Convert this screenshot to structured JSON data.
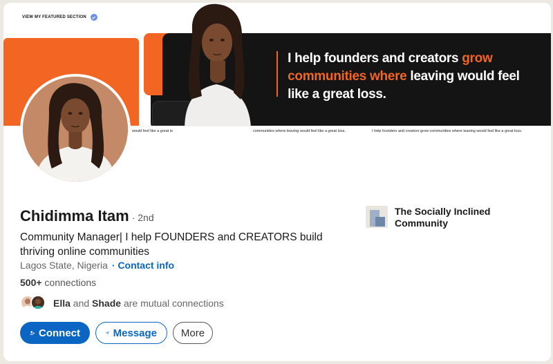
{
  "banner": {
    "featured_label": "VIEW MY FEATURED SECTION",
    "headline_parts": [
      {
        "text": "I help ",
        "highlight": false
      },
      {
        "text": "founders and creators ",
        "highlight": false
      },
      {
        "text": "grow ",
        "highlight": true
      },
      {
        "text": "communities where ",
        "highlight": true
      },
      {
        "text": "leaving would feel like a great loss.",
        "highlight": false
      }
    ],
    "strip_texts": [
      "would feel like a great lo",
      "communities where leaving would feel like a great loss.",
      "I help founders and creators grow communities where leaving would feel like a great loss."
    ]
  },
  "profile": {
    "name": "Chidimma Itam",
    "degree": "· 2nd",
    "headline": "Community Manager| I help  FOUNDERS and CREATORS build thriving online communities",
    "location": "Lagos State, Nigeria",
    "contact_label": "· Contact info",
    "connections_count": "500+",
    "connections_label": " connections",
    "mutual": {
      "name1": "Ella",
      "and": " and ",
      "name2": "Shade",
      "suffix": " are mutual connections"
    }
  },
  "actions": {
    "connect": "Connect",
    "message": "Message",
    "more": "More"
  },
  "company": {
    "name": "The Socially Inclined Community"
  },
  "colors": {
    "brand_blue": "#0a66c2",
    "banner_orange": "#f26522",
    "banner_dark": "#141414"
  }
}
